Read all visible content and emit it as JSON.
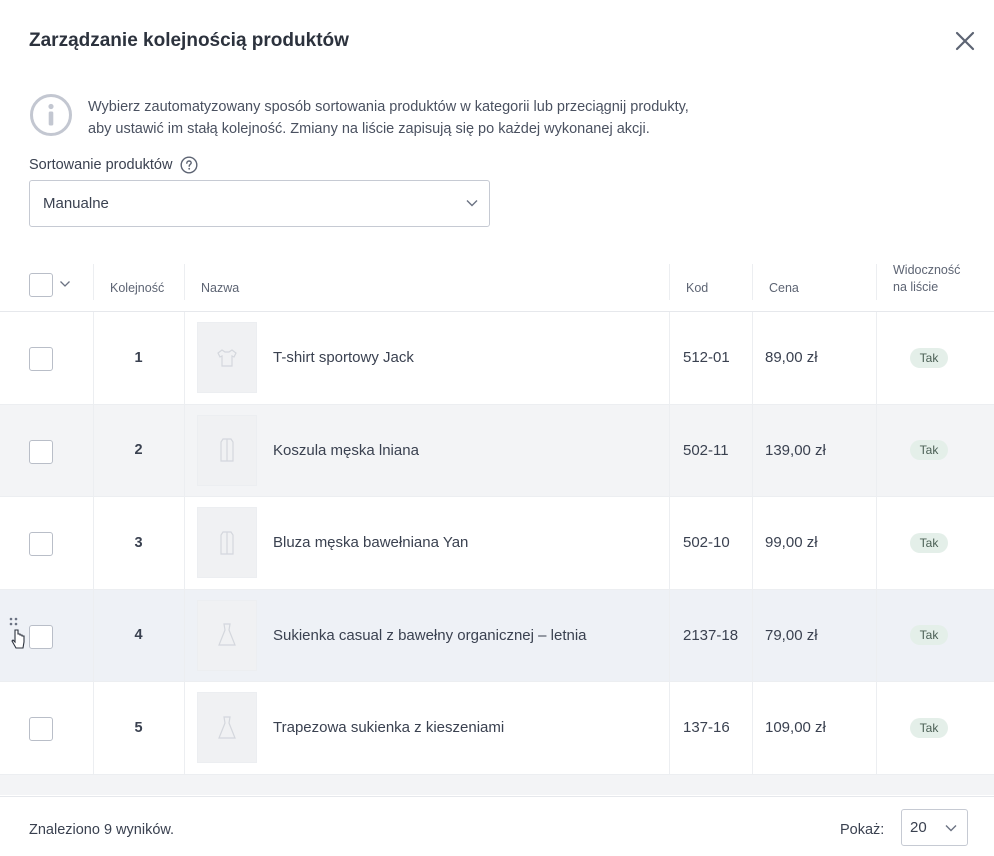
{
  "modal": {
    "title": "Zarządzanie kolejnością produktów",
    "info_line1": "Wybierz zautomatyzowany sposób sortowania produktów w kategorii lub przeciągnij produkty,",
    "info_line2": "aby ustawić im stałą kolejność. Zmiany na liście zapisują się po każdej wykonanej akcji."
  },
  "sorting": {
    "label": "Sortowanie produktów",
    "selected": "Manualne"
  },
  "table": {
    "headers": {
      "order": "Kolejność",
      "name": "Nazwa",
      "code": "Kod",
      "price": "Cena",
      "visibility_line1": "Widoczność",
      "visibility_line2": "na liście"
    },
    "rows": [
      {
        "order": "1",
        "name": "T-shirt sportowy Jack",
        "code": "512-01",
        "price": "89,00 zł",
        "visibility": "Tak",
        "icon": "tshirt-icon"
      },
      {
        "order": "2",
        "name": "Koszula męska lniana",
        "code": "502-11",
        "price": "139,00 zł",
        "visibility": "Tak",
        "icon": "shirt-icon"
      },
      {
        "order": "3",
        "name": "Bluza męska bawełniana Yan",
        "code": "502-10",
        "price": "99,00 zł",
        "visibility": "Tak",
        "icon": "hoodie-icon"
      },
      {
        "order": "4",
        "name": "Sukienka casual z bawełny organicznej – letnia",
        "code": "2137-18",
        "price": "79,00 zł",
        "visibility": "Tak",
        "icon": "dress-icon"
      },
      {
        "order": "5",
        "name": "Trapezowa sukienka z kieszeniami",
        "code": "137-16",
        "price": "109,00 zł",
        "visibility": "Tak",
        "icon": "dress-icon"
      }
    ]
  },
  "footer": {
    "found": "Znaleziono 9 wyników.",
    "show_label": "Pokaż:",
    "page_size": "20"
  },
  "colors": {
    "badge_bg": "#e4efe9",
    "row_shaded": "#f3f4f6",
    "border": "#c6cad3"
  }
}
